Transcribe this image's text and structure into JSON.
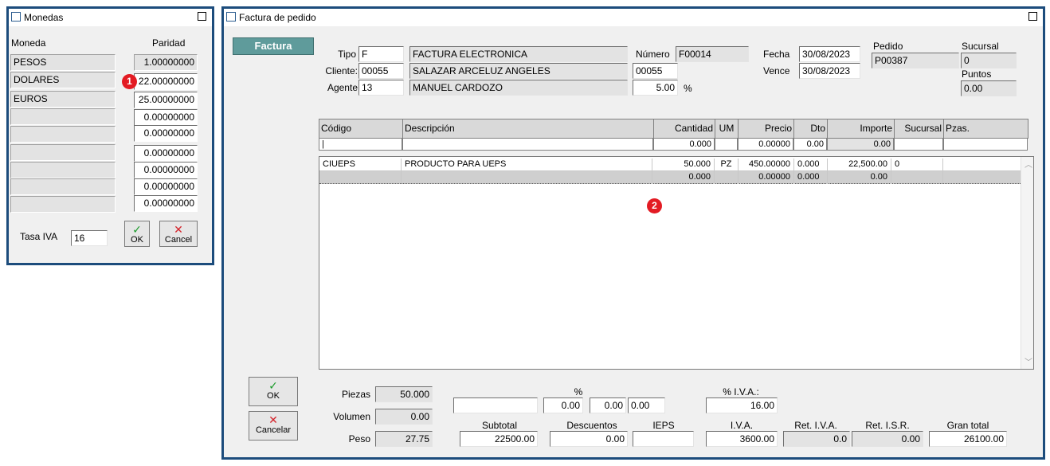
{
  "monedas": {
    "title": "Monedas",
    "col_moneda": "Moneda",
    "col_paridad": "Paridad",
    "rows": [
      {
        "name": "PESOS",
        "paridad": "1.00000000"
      },
      {
        "name": "DOLARES",
        "paridad": "22.00000000"
      },
      {
        "name": "EUROS",
        "paridad": "25.00000000"
      },
      {
        "name": "",
        "paridad": "0.00000000"
      },
      {
        "name": "",
        "paridad": "0.00000000"
      },
      {
        "name": "",
        "paridad": "0.00000000"
      },
      {
        "name": "",
        "paridad": "0.00000000"
      },
      {
        "name": "",
        "paridad": "0.00000000"
      },
      {
        "name": "",
        "paridad": "0.00000000"
      }
    ],
    "tasa_iva_label": "Tasa IVA",
    "tasa_iva_value": "16",
    "ok_label": "OK",
    "cancel_label": "Cancel",
    "badge": "1"
  },
  "factura": {
    "title": "Factura de pedido",
    "tab_label": "Factura",
    "tipo_label": "Tipo",
    "tipo_code": "F",
    "tipo_desc": "FACTURA ELECTRONICA",
    "numero_label": "Número",
    "numero_value": "F00014",
    "fecha_label": "Fecha",
    "fecha_value": "30/08/2023",
    "vence_label": "Vence",
    "vence_value": "30/08/2023",
    "pedido_label": "Pedido",
    "pedido_value": "P00387",
    "sucursal_label": "Sucursal",
    "sucursal_value": "0",
    "puntos_label": "Puntos",
    "puntos_value": "0.00",
    "cliente_label": "Cliente:",
    "cliente_code": "00055",
    "cliente_name": "SALAZAR ARCELUZ ANGELES",
    "cliente_code2": "00055",
    "agente_label": "Agente",
    "agente_code": "13",
    "agente_name": "MANUEL CARDOZO",
    "agente_pct": "5.00",
    "pct_sign": "%",
    "grid_headers": {
      "codigo": "Código",
      "descripcion": "Descripción",
      "cantidad": "Cantidad",
      "um": "UM",
      "precio": "Precio",
      "dto": "Dto",
      "importe": "Importe",
      "sucursal": "Sucursal",
      "pzas": "Pzas."
    },
    "entry_row": {
      "cantidad": "0.000",
      "precio": "0.00000",
      "dto": "0.00",
      "importe": "0.00"
    },
    "lines": [
      {
        "codigo": "CIUEPS",
        "descripcion": "PRODUCTO PARA UEPS",
        "cantidad": "50.000",
        "um": "PZ",
        "precio": "450.00000",
        "dto": "0.000",
        "importe": "22,500.00",
        "sucursal": "0"
      },
      {
        "codigo": "",
        "descripcion": "",
        "cantidad": "0.000",
        "um": "",
        "precio": "0.00000",
        "dto": "0.000",
        "importe": "0.00",
        "sucursal": ""
      }
    ],
    "badge": "2",
    "ok_label": "OK",
    "cancel_label": "Cancelar",
    "piezas_label": "Piezas",
    "piezas_value": "50.000",
    "volumen_label": "Volumen",
    "volumen_value": "0.00",
    "peso_label": "Peso",
    "peso_value": "27.75",
    "pct_header": "%",
    "desc_pct1": "0.00",
    "desc_pct2": "0.00",
    "desc_pct3": "0.00",
    "pct_iva_label": "% I.V.A.:",
    "pct_iva_value": "16.00",
    "subtotal_label": "Subtotal",
    "subtotal_value": "22500.00",
    "descuentos_label": "Descuentos",
    "descuentos_value": "0.00",
    "ieps_label": "IEPS",
    "ieps_value": "",
    "iva_label": "I.V.A.",
    "iva_value": "3600.00",
    "ret_iva_label": "Ret. I.V.A.",
    "ret_iva_value": "0.0",
    "ret_isr_label": "Ret. I.S.R.",
    "ret_isr_value": "0.00",
    "gran_total_label": "Gran total",
    "gran_total_value": "26100.00"
  }
}
